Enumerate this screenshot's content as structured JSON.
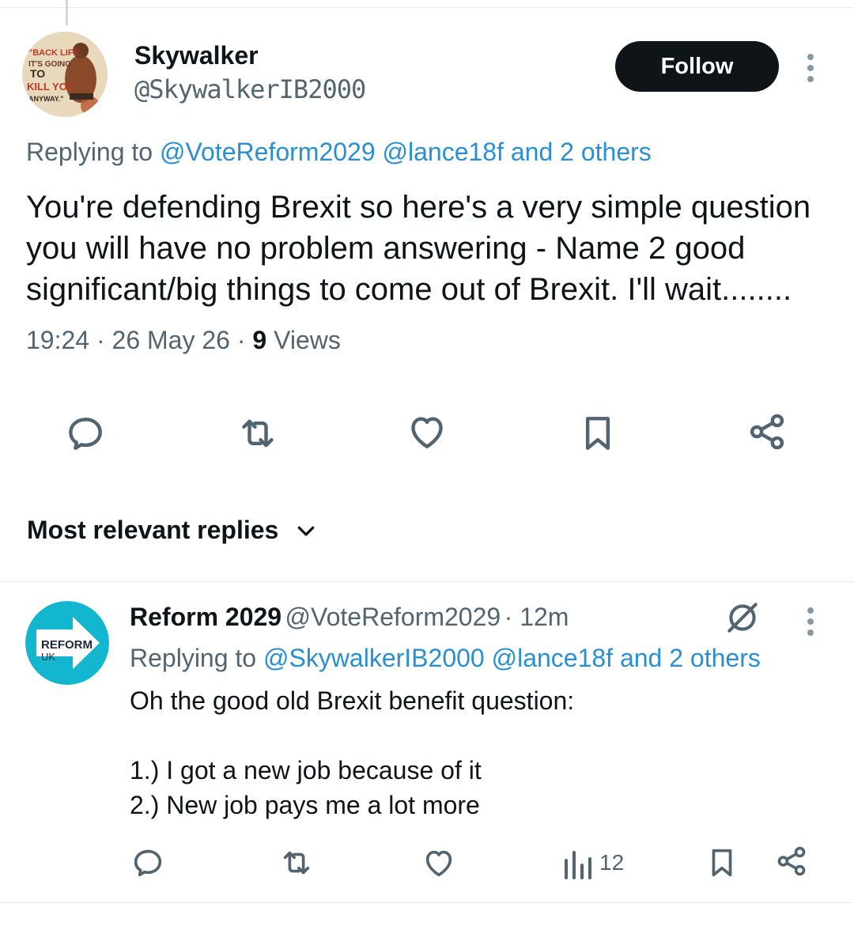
{
  "main_tweet": {
    "author_name": "Skywalker",
    "author_handle": "@SkywalkerIB2000",
    "avatar_text": [
      "\"BACK LIFE,",
      "IT'S GOING",
      "TO",
      "KILL YOU",
      "ANYWAY.\""
    ],
    "follow_label": "Follow",
    "replying_prefix": "Replying to",
    "replying_mentions": "@VoteReform2029 @lance18f and 2 others",
    "text_lines": [
      "You're defending Brexit so here's a very simple question",
      "you will have no problem answering - Name 2 good",
      "significant/big things to come out of Brexit. I'll wait........"
    ],
    "time": "19:24",
    "date": "26 May 26",
    "views_count": "9",
    "views_label": "Views",
    "actions": [
      "reply",
      "retweet",
      "like",
      "bookmark",
      "share"
    ]
  },
  "replies_sort": {
    "label": "Most relevant replies"
  },
  "reply": {
    "author_name": "Reform 2029",
    "author_handle": "@VoteReform2029",
    "time_ago": "12m",
    "avatar_text": [
      "REFORM",
      "UK"
    ],
    "replying_prefix": "Replying to",
    "replying_mentions": "@SkywalkerIB2000 @lance18f and 2 others",
    "text_lines": [
      "Oh the good old Brexit benefit question:",
      "",
      "1.) I got a new job because of it",
      "2.) New job pays me a lot more"
    ],
    "views_count": "12"
  },
  "colors": {
    "link": "#2a8fd0",
    "secondary": "#536471",
    "reform_brand": "#12b6cf"
  }
}
